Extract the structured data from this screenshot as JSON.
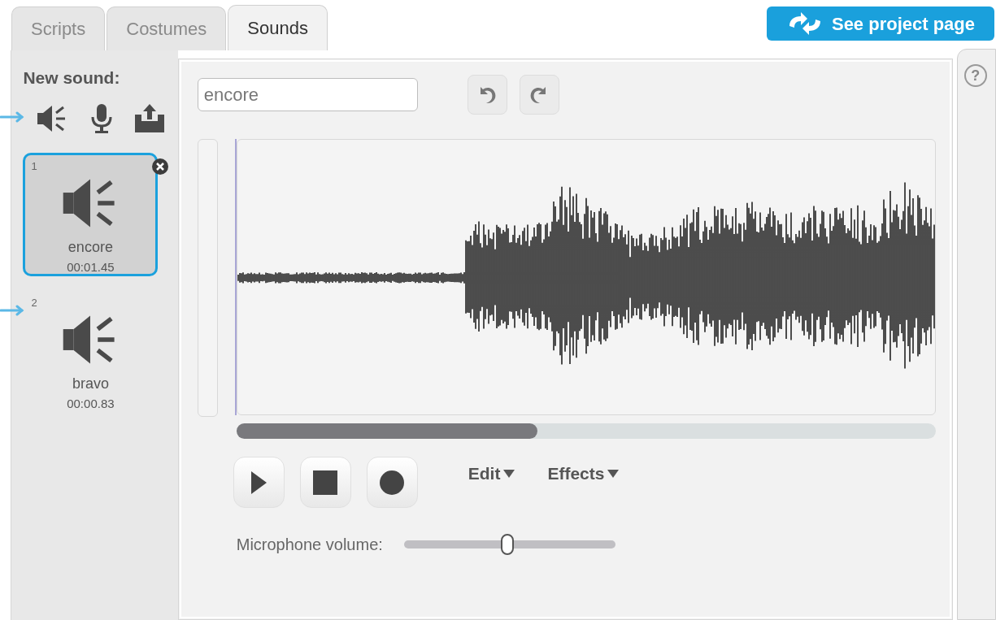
{
  "tabs": [
    {
      "label": "Scripts",
      "selected": false
    },
    {
      "label": "Costumes",
      "selected": false
    },
    {
      "label": "Sounds",
      "selected": true
    }
  ],
  "project_button": {
    "label": "See project page"
  },
  "new_sound": {
    "label": "New sound:"
  },
  "sounds": [
    {
      "number": "1",
      "name": "encore",
      "duration": "00:01.45",
      "selected": true
    },
    {
      "number": "2",
      "name": "bravo",
      "duration": "00:00.83",
      "selected": false
    }
  ],
  "editor": {
    "sound_name": "encore",
    "menus": [
      "Edit",
      "Effects"
    ],
    "microphone_volume": {
      "label": "Microphone volume:",
      "level": 0.49
    }
  },
  "help": {
    "label": "?"
  }
}
